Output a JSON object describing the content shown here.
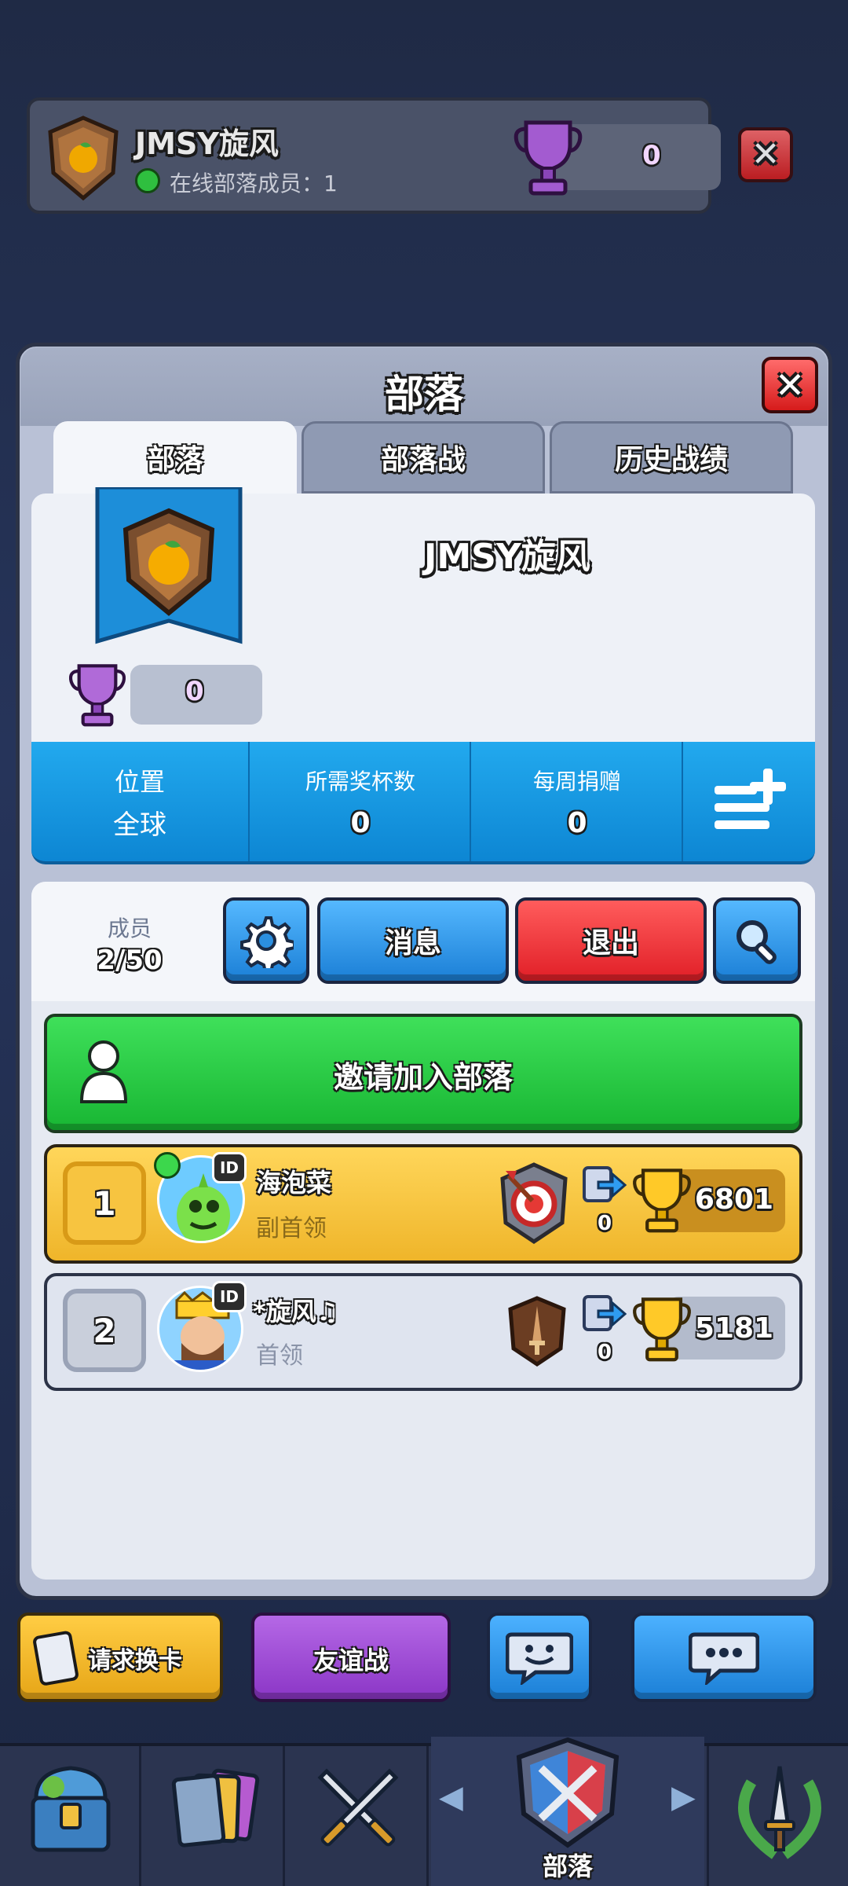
{
  "top_banner": {
    "clan_name": "JMSY旋风",
    "online_text": "在线部落成员：1",
    "trophy_value": "0"
  },
  "dialog": {
    "title": "部落",
    "tabs": [
      {
        "label": "部落",
        "active": true
      },
      {
        "label": "部落战",
        "active": false
      },
      {
        "label": "历史战绩",
        "active": false
      }
    ],
    "clan_name": "JMSY旋风",
    "clan_trophy": "0",
    "stats": [
      {
        "label": "位置",
        "value": "全球"
      },
      {
        "label": "所需奖杯数",
        "value": "0"
      },
      {
        "label": "每周捐赠",
        "value": "0"
      }
    ],
    "members_label": "成员",
    "members_count": "2/50",
    "message_button": "消息",
    "exit_button": "退出",
    "invite_button": "邀请加入部落",
    "members": [
      {
        "rank": "1",
        "name": "海泡菜",
        "role": "副首领",
        "donations": "0",
        "trophies": "6801",
        "online": true,
        "id_badge": "ID"
      },
      {
        "rank": "2",
        "name": "*旋风♫",
        "role": "首领",
        "donations": "0",
        "trophies": "5181",
        "online": false,
        "id_badge": "ID"
      }
    ]
  },
  "action_bar": {
    "request_card": "请求换卡",
    "friendly_battle": "友谊战"
  },
  "bottom_nav": {
    "active_label": "部落",
    "items": [
      "shop-chest-icon",
      "cards-icon",
      "battle-swords-icon",
      "clan-shield-icon",
      "events-laurel-icon"
    ]
  },
  "colors": {
    "accent_blue": "#1aa0e8",
    "gold_row": "#f5c33a",
    "green_invite": "#2fc94a",
    "exit_red": "#ef3a3f",
    "purple_trophy": "#b06ad8"
  }
}
